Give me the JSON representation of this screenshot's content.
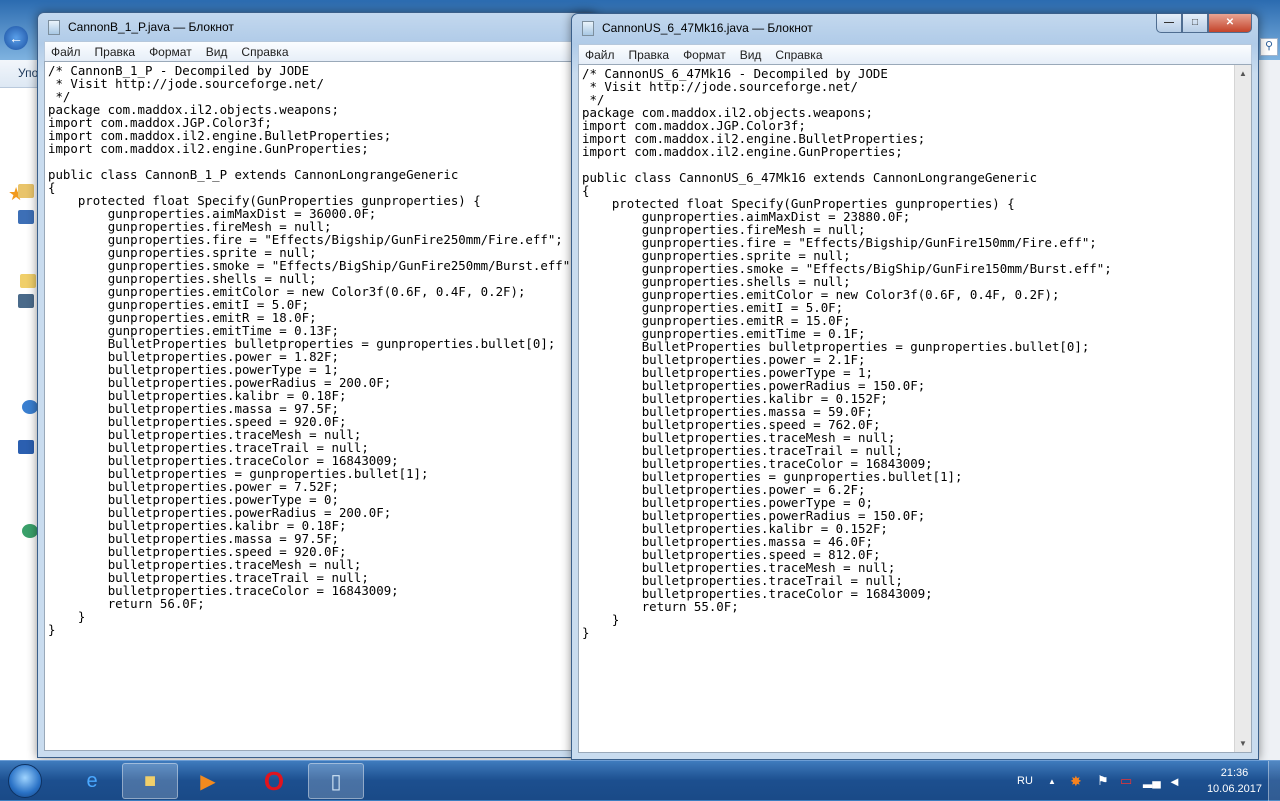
{
  "explorer": {
    "toolbar_partial": "Упо"
  },
  "left_window": {
    "title": "CannonB_1_P.java — Блокнот",
    "menu": [
      "Файл",
      "Правка",
      "Формат",
      "Вид",
      "Справка"
    ],
    "content": "/* CannonB_1_P - Decompiled by JODE\n * Visit http://jode.sourceforge.net/\n */\npackage com.maddox.il2.objects.weapons;\nimport com.maddox.JGP.Color3f;\nimport com.maddox.il2.engine.BulletProperties;\nimport com.maddox.il2.engine.GunProperties;\n\npublic class CannonB_1_P extends CannonLongrangeGeneric\n{\n    protected float Specify(GunProperties gunproperties) {\n\tgunproperties.aimMaxDist = 36000.0F;\n\tgunproperties.fireMesh = null;\n\tgunproperties.fire = \"Effects/Bigship/GunFire250mm/Fire.eff\";\n\tgunproperties.sprite = null;\n\tgunproperties.smoke = \"Effects/BigShip/GunFire250mm/Burst.eff\";\n\tgunproperties.shells = null;\n\tgunproperties.emitColor = new Color3f(0.6F, 0.4F, 0.2F);\n\tgunproperties.emitI = 5.0F;\n\tgunproperties.emitR = 18.0F;\n\tgunproperties.emitTime = 0.13F;\n\tBulletProperties bulletproperties = gunproperties.bullet[0];\n\tbulletproperties.power = 1.82F;\n\tbulletproperties.powerType = 1;\n\tbulletproperties.powerRadius = 200.0F;\n\tbulletproperties.kalibr = 0.18F;\n\tbulletproperties.massa = 97.5F;\n\tbulletproperties.speed = 920.0F;\n\tbulletproperties.traceMesh = null;\n\tbulletproperties.traceTrail = null;\n\tbulletproperties.traceColor = 16843009;\n\tbulletproperties = gunproperties.bullet[1];\n\tbulletproperties.power = 7.52F;\n\tbulletproperties.powerType = 0;\n\tbulletproperties.powerRadius = 200.0F;\n\tbulletproperties.kalibr = 0.18F;\n\tbulletproperties.massa = 97.5F;\n\tbulletproperties.speed = 920.0F;\n\tbulletproperties.traceMesh = null;\n\tbulletproperties.traceTrail = null;\n\tbulletproperties.traceColor = 16843009;\n\treturn 56.0F;\n    }\n}"
  },
  "right_window": {
    "title": "CannonUS_6_47Mk16.java — Блокнот",
    "menu": [
      "Файл",
      "Правка",
      "Формат",
      "Вид",
      "Справка"
    ],
    "content": "/* CannonUS_6_47Mk16 - Decompiled by JODE\n * Visit http://jode.sourceforge.net/\n */\npackage com.maddox.il2.objects.weapons;\nimport com.maddox.JGP.Color3f;\nimport com.maddox.il2.engine.BulletProperties;\nimport com.maddox.il2.engine.GunProperties;\n\npublic class CannonUS_6_47Mk16 extends CannonLongrangeGeneric\n{\n    protected float Specify(GunProperties gunproperties) {\n\tgunproperties.aimMaxDist = 23880.0F;\n\tgunproperties.fireMesh = null;\n\tgunproperties.fire = \"Effects/Bigship/GunFire150mm/Fire.eff\";\n\tgunproperties.sprite = null;\n\tgunproperties.smoke = \"Effects/BigShip/GunFire150mm/Burst.eff\";\n\tgunproperties.shells = null;\n\tgunproperties.emitColor = new Color3f(0.6F, 0.4F, 0.2F);\n\tgunproperties.emitI = 5.0F;\n\tgunproperties.emitR = 15.0F;\n\tgunproperties.emitTime = 0.1F;\n\tBulletProperties bulletproperties = gunproperties.bullet[0];\n\tbulletproperties.power = 2.1F;\n\tbulletproperties.powerType = 1;\n\tbulletproperties.powerRadius = 150.0F;\n\tbulletproperties.kalibr = 0.152F;\n\tbulletproperties.massa = 59.0F;\n\tbulletproperties.speed = 762.0F;\n\tbulletproperties.traceMesh = null;\n\tbulletproperties.traceTrail = null;\n\tbulletproperties.traceColor = 16843009;\n\tbulletproperties = gunproperties.bullet[1];\n\tbulletproperties.power = 6.2F;\n\tbulletproperties.powerType = 0;\n\tbulletproperties.powerRadius = 150.0F;\n\tbulletproperties.kalibr = 0.152F;\n\tbulletproperties.massa = 46.0F;\n\tbulletproperties.speed = 812.0F;\n\tbulletproperties.traceMesh = null;\n\tbulletproperties.traceTrail = null;\n\tbulletproperties.traceColor = 16843009;\n\treturn 55.0F;\n    }\n}"
  },
  "taskbar": {
    "language": "RU",
    "time": "21:36",
    "date": "10.06.2017"
  }
}
